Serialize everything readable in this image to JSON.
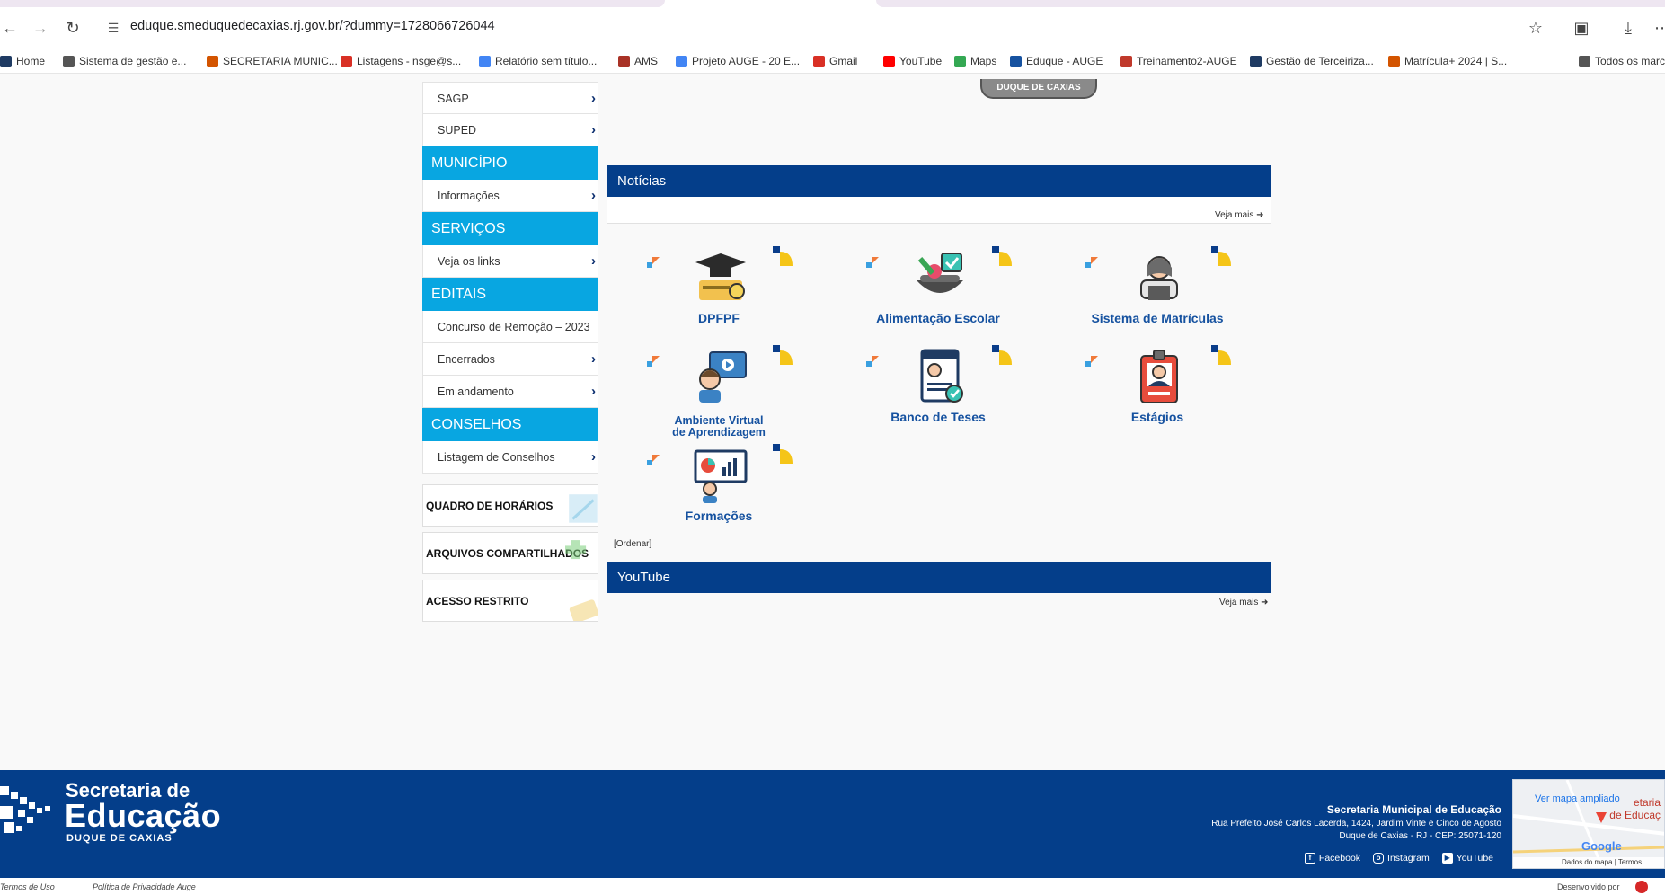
{
  "browser": {
    "url": "eduque.smeduquedecaxias.rj.gov.br/?dummy=1728066726044",
    "bookmarks": [
      {
        "label": "Home",
        "color": "#1f3b63"
      },
      {
        "label": "Sistema de gestão e...",
        "color": "#555555"
      },
      {
        "label": "SECRETARIA MUNIC...",
        "color": "#d35400"
      },
      {
        "label": "Listagens - nsge@s...",
        "color": "#d93025"
      },
      {
        "label": "Relatório sem título...",
        "color": "#4285f4"
      },
      {
        "label": "AMS",
        "color": "#a93226"
      },
      {
        "label": "Projeto AUGE - 20 E...",
        "color": "#4285f4"
      },
      {
        "label": "Gmail",
        "color": "#d93025"
      },
      {
        "label": "YouTube",
        "color": "#ff0000"
      },
      {
        "label": "Maps",
        "color": "#34a853"
      },
      {
        "label": "Eduque - AUGE",
        "color": "#1652a0"
      },
      {
        "label": "Treinamento2-AUGE",
        "color": "#c0392b"
      },
      {
        "label": "Gestão de Terceiriza...",
        "color": "#1f3b63"
      },
      {
        "label": "Matrícula+ 2024 | S...",
        "color": "#d35400"
      },
      {
        "label": "Todos os marc",
        "color": "#555555"
      }
    ]
  },
  "header": {
    "logo_tab": "DUQUE DE CAXIAS"
  },
  "sidebar": {
    "top_items": [
      "SAGP",
      "SUPED"
    ],
    "sections": [
      {
        "title": "MUNICÍPIO",
        "items": [
          "Informações"
        ]
      },
      {
        "title": "SERVIÇOS",
        "items": [
          "Veja os links"
        ]
      },
      {
        "title": "EDITAIS",
        "items": [
          "Concurso de Remoção – 2023",
          "Encerrados",
          "Em andamento"
        ]
      },
      {
        "title": "CONSELHOS",
        "items": [
          "Listagem de Conselhos"
        ]
      }
    ],
    "boxes": [
      "QUADRO DE HORÁRIOS",
      "ARQUIVOS COMPARTILHADOS",
      "ACESSO RESTRITO"
    ]
  },
  "news": {
    "title": "Notícias",
    "more": "Veja mais",
    "tiles": [
      {
        "label": "DPFPF",
        "icon": "graduation-cap-icon"
      },
      {
        "label": "Alimentação Escolar",
        "icon": "food-bowl-icon"
      },
      {
        "label": "Sistema de Matrículas",
        "icon": "student-laptop-icon"
      },
      {
        "label": "Ambiente Virtual de Aprendizagem",
        "line1": "Ambiente Virtual",
        "line2": "de Aprendizagem",
        "icon": "e-learning-icon"
      },
      {
        "label": "Banco de Teses",
        "icon": "document-check-icon"
      },
      {
        "label": "Estágios",
        "icon": "id-badge-icon"
      },
      {
        "label": "Formações",
        "icon": "presentation-board-icon"
      }
    ],
    "order": "[Ordenar]"
  },
  "youtube": {
    "title": "YouTube",
    "more": "Veja mais"
  },
  "footer": {
    "logo_line1": "Secretaria de",
    "logo_line2": "Educação",
    "logo_line3": "DUQUE DE CAXIAS",
    "org": "Secretaria Municipal de Educação",
    "address1": "Rua Prefeito José Carlos Lacerda, 1424, Jardim Vinte e Cinco de Agosto",
    "address2": "Duque de Caxias - RJ - CEP: 25071-120",
    "social": [
      "Facebook",
      "Instagram",
      "YouTube"
    ],
    "map_link": "Ver mapa ampliado",
    "map_text1": "etaria",
    "map_text2": "de Educaç",
    "map_google": "Google",
    "map_credit": "Dados do mapa | Termos"
  },
  "bottom": {
    "terms": "Termos de Uso",
    "privacy": "Política de Privacidade Auge",
    "dev": "Desenvolvido por"
  },
  "colors": {
    "primary": "#043e8a",
    "accent": "#08a6e1"
  }
}
